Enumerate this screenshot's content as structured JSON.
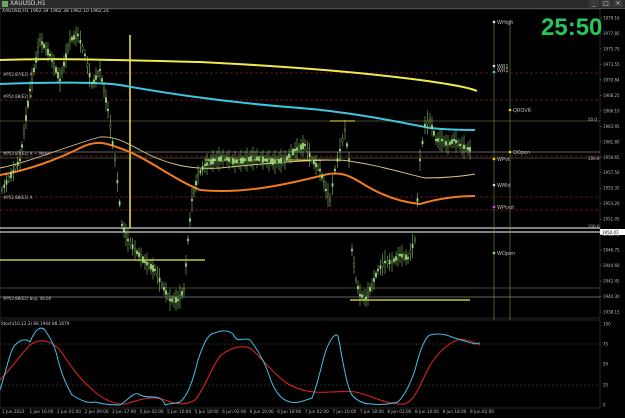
{
  "window": {
    "title": "XAUUSD,H1",
    "symbol_line": "XAUUSD,H1  1962.34 1962.38 1962.10 1962.24",
    "buttons": [
      "_",
      "□",
      "×"
    ]
  },
  "clock": "25:50",
  "price_axis": [
    "1979.16",
    "1977.85",
    "1975.70",
    "1973.55",
    "1970.84",
    "1968.25",
    "1966.10",
    "1963.95",
    "1961.80",
    "1959.65",
    "1957.50",
    "1955.35",
    "1953.20",
    "1951.05",
    "1948.90",
    "1946.75",
    "1944.60",
    "1942.45",
    "1940.30",
    "1938.15"
  ],
  "level_labels": {
    "l1": "#P53.87(E2) A",
    "l2": "#P54.88(E2) A",
    "l3": "#P53.87(E2) A — Mean",
    "l4": "#P52.88(E2) A",
    "l5": "#P53.88(E2) buy, 46.00"
  },
  "weekly_levels": {
    "whigh": "WHigh",
    "wr1": "WR1",
    "wr1b": "WR1",
    "qrovr": "QROVR",
    "qopen": "QOpen",
    "wpivot": "WPvt",
    "wmid": "WMid",
    "wpivot2": "WPivot",
    "wopen": "WOpen"
  },
  "right_price_tags": {
    "t1": "50.0",
    "t2": "100.0",
    "t3": "100.0",
    "t4": "1950.07"
  },
  "stoch": {
    "label": "Stoch(10,12,3) 88.1944 88.1679",
    "axis": [
      "100",
      "75",
      "50",
      "25",
      "0"
    ]
  },
  "time_axis": [
    "1 Jun 2023",
    "1 Jun 16:00",
    "2 Jun 01:00",
    "2 Jun 09:00",
    "2 Jun 17:00",
    "5 Jun 02:00",
    "5 Jun 10:00",
    "5 Jun 18:00",
    "6 Jun 02:00",
    "6 Jun 10:00",
    "6 Jun 18:00",
    "7 Jun 02:00",
    "7 Jun 10:00",
    "7 Jun 18:00",
    "8 Jun 02:00",
    "8 Jun 10:00",
    "8 Jun 18:00",
    "9 Jun 02:00"
  ],
  "colors": {
    "background": "#000000",
    "bull_candle": "#9ee07a",
    "yellow_ma": "#f2ea4a",
    "cyan_ma": "#3cc8e0",
    "orange_ma": "#f07a20",
    "tan_ma": "#d8c88a",
    "clock": "#27c45a",
    "stoch_main": "#42c0ec",
    "stoch_signal": "#e02020"
  }
}
